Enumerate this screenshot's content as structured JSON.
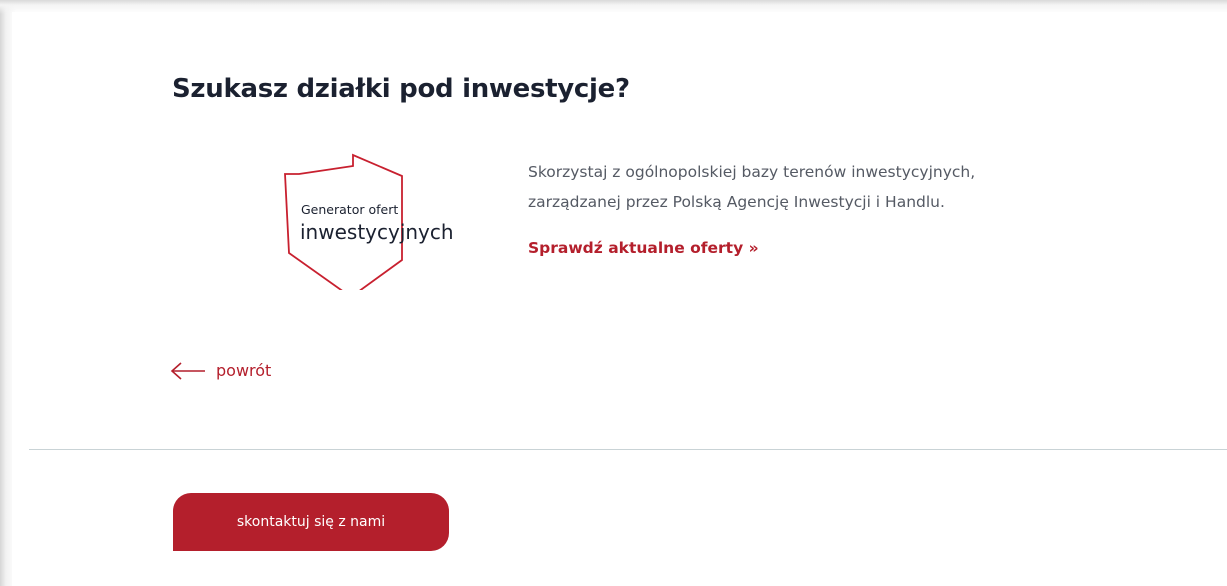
{
  "section": {
    "title": "Szukasz działki pod inwestycje?",
    "description_line1": "Skorzystaj z ogólnopolskiej bazy terenów inwestycyjnych,",
    "description_line2": "zarządzanej przez Polską Agencję Inwestycji i Handlu.",
    "offers_link": "Sprawdź aktualne oferty »"
  },
  "logo": {
    "line1": "Generator ofert",
    "line2": "inwestycyjnych",
    "outline_color": "#c8202f"
  },
  "navigation": {
    "back_label": "powrót",
    "back_icon": "arrow-left-icon"
  },
  "contact": {
    "button_label": "skontaktuj się z nami"
  },
  "colors": {
    "accent": "#b41f2c",
    "title": "#1b2130",
    "body_text": "#555a64",
    "divider": "#c9d3d6"
  }
}
